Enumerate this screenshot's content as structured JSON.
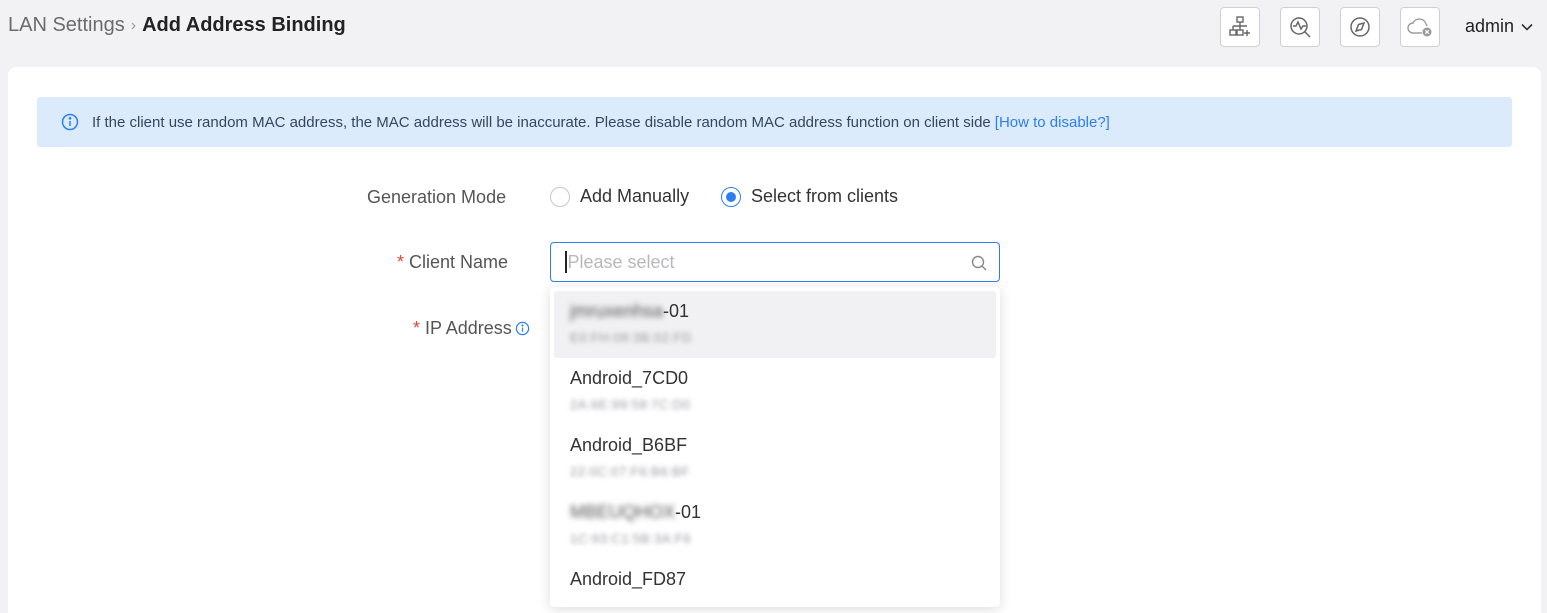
{
  "breadcrumb": {
    "parent": "LAN Settings",
    "separator": ">",
    "current": "Add Address Binding"
  },
  "toolbar": {
    "icons": [
      "network-add-icon",
      "diagnostics-icon",
      "compass-icon",
      "cloud-offline-icon"
    ]
  },
  "user": {
    "name": "admin"
  },
  "notice": {
    "text": "If the client use random MAC address, the MAC address will be inaccurate. Please disable random MAC address function on client side",
    "link": "[How to disable?]"
  },
  "form": {
    "generation_mode": {
      "label": "Generation Mode",
      "options": [
        "Add Manually",
        "Select from clients"
      ],
      "selected": "Select from clients"
    },
    "client_name": {
      "label": "Client Name",
      "placeholder": "Please select",
      "required_mark": "*"
    },
    "ip_address": {
      "label": "IP Address",
      "required_mark": "*"
    }
  },
  "dropdown": {
    "options": [
      {
        "name_blurred": "jmruxenhsa",
        "name": "-01",
        "mac": "E0:FH:09:3B:02:FD"
      },
      {
        "name": "Android_7CD0",
        "mac": "2A:6E:99:58:7C:D0"
      },
      {
        "name": "Android_B6BF",
        "mac": "22:0C:07:F6:B6:BF"
      },
      {
        "name_blurred": "MBEUQHOX",
        "name": "-01",
        "mac": "1C:93:C1:5B:3A:F6"
      },
      {
        "name": "Android_FD87",
        "mac": ""
      }
    ]
  },
  "colors": {
    "accent": "#2d7ff0",
    "required": "#e8423a",
    "notice_bg": "#dcebfb"
  }
}
